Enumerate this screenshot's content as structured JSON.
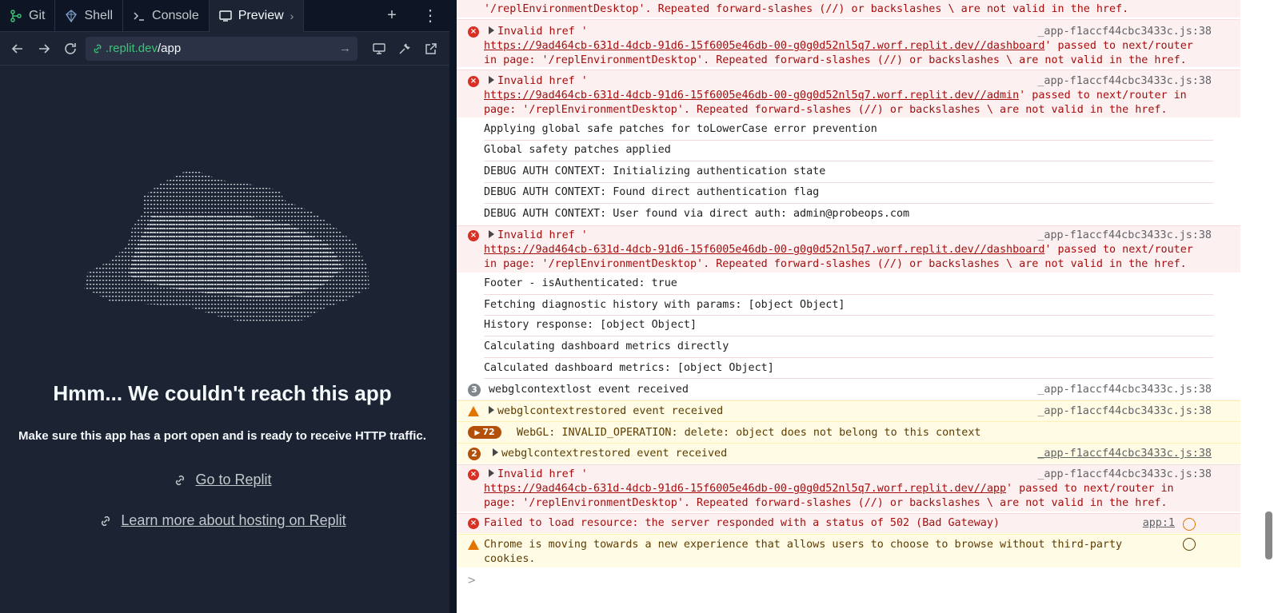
{
  "tabs": [
    {
      "label": "Git",
      "icon": "git-icon"
    },
    {
      "label": "Shell",
      "icon": "shell-icon"
    },
    {
      "label": "Console",
      "icon": "console-icon"
    },
    {
      "label": "Preview",
      "icon": "preview-icon",
      "active": true
    }
  ],
  "url": {
    "host": ".replit.dev",
    "path": "/app"
  },
  "preview": {
    "title": "Hmm... We couldn't reach this app",
    "subtitle": "Make sure this app has a port open and is ready to receive HTTP traffic.",
    "link_replit": "Go to Replit",
    "link_hosting": "Learn more about hosting on Replit"
  },
  "console": {
    "r0": "'/replEnvironmentDesktop'. Repeated forward-slashes (//) or backslashes \\ are not valid in the href.",
    "r1_head": "Invalid href '",
    "r1_url": "https://9ad464cb-631d-4dcb-91d6-15f6005e46db-00-g0g0d52nl5q7.worf.replit.dev//dashboard",
    "r1_tail": "' passed to next/router",
    "r1_line3": "in page: '/replEnvironmentDesktop'. Repeated forward-slashes (//) or backslashes \\ are not valid in the href.",
    "r2_head": "Invalid href '",
    "r2_url": "https://9ad464cb-631d-4dcb-91d6-15f6005e46db-00-g0g0d52nl5q7.worf.replit.dev//admin",
    "r2_tail": "' passed to next/router in",
    "r2_line3": "page: '/replEnvironmentDesktop'. Repeated forward-slashes (//) or backslashes \\ are not valid in the href.",
    "log1": "Applying global safe patches for toLowerCase error prevention",
    "log2": "Global safety patches applied",
    "log3": "DEBUG AUTH CONTEXT: Initializing authentication state",
    "log4": "DEBUG AUTH CONTEXT: Found direct authentication flag",
    "log5": "DEBUG AUTH CONTEXT: User found via direct auth: admin@probeops.com",
    "r3_head": "Invalid href '",
    "r3_url": "https://9ad464cb-631d-4dcb-91d6-15f6005e46db-00-g0g0d52nl5q7.worf.replit.dev//dashboard",
    "r3_tail": "' passed to next/router",
    "r3_line3": "in page: '/replEnvironmentDesktop'. Repeated forward-slashes (//) or backslashes \\ are not valid in the href.",
    "log6": "Footer - isAuthenticated: true",
    "log7": "Fetching diagnostic history with params: [object Object]",
    "log8": "History response: [object Object]",
    "log9": "Calculating dashboard metrics directly",
    "log10": "Calculated dashboard metrics: [object Object]",
    "webgl_lost": "webglcontextlost event received",
    "webgl_lost_count": "3",
    "webgl_restored": "webglcontextrestored event received",
    "webgl_invalid": "WebGL: INVALID_OPERATION: delete: object does not belong to this context",
    "webgl_invalid_count": "72",
    "webgl_restored2": "webglcontextrestored event received",
    "webgl_restored2_count": "2",
    "r4_head": "Invalid href '",
    "r4_url": "https://9ad464cb-631d-4dcb-91d6-15f6005e46db-00-g0g0d52nl5q7.worf.replit.dev//app",
    "r4_tail": "' passed to next/router in",
    "r4_line3": "page: '/replEnvironmentDesktop'. Repeated forward-slashes (//) or backslashes \\ are not valid in the href.",
    "failed": "Failed to load resource: the server responded with a status of 502 (Bad Gateway)",
    "failed_src": "app:1",
    "chrome_l1": "Chrome is moving towards a new experience that allows users to choose to browse without third-party",
    "chrome_l2": "cookies.",
    "source": "_app-f1accf44cbc3433c.js:38",
    "prompt": ">"
  },
  "colors": {
    "accent_green": "#3cc278",
    "error_red": "#d93025",
    "warn_orange": "#e37400",
    "bg_dark": "#1c2333"
  }
}
